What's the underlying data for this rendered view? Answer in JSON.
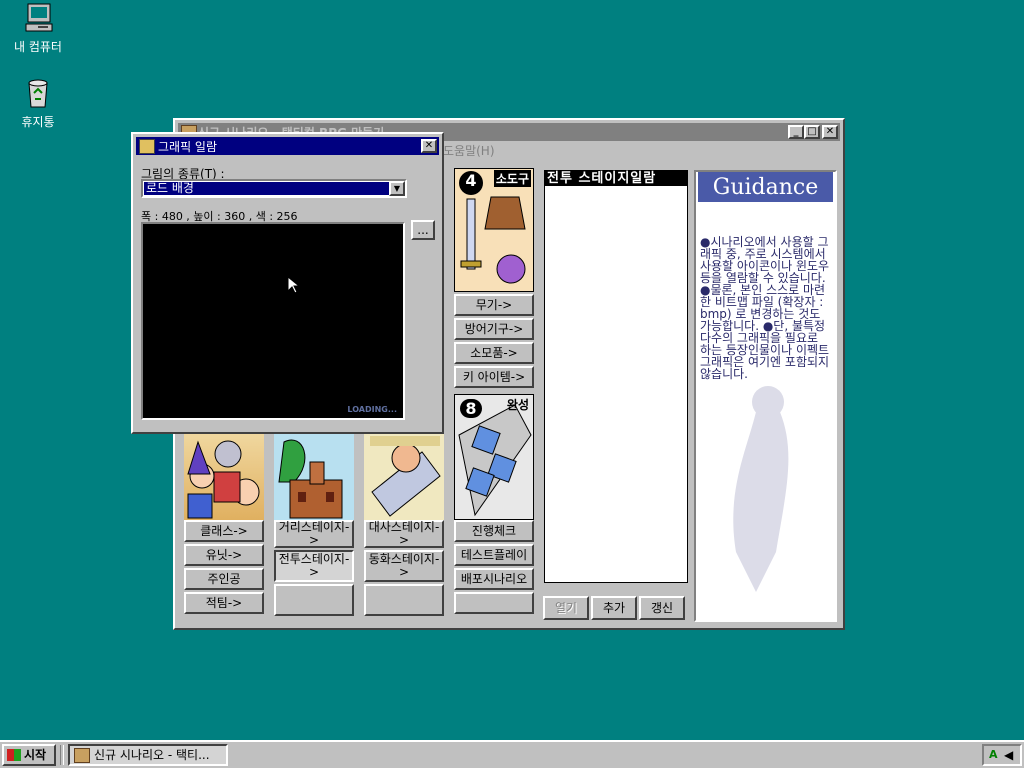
{
  "desktop": {
    "icons": [
      {
        "label": "내 컴퓨터",
        "icon": "my-computer-icon"
      },
      {
        "label": "휴지통",
        "icon": "recycle-bin-icon"
      }
    ]
  },
  "main_window": {
    "title": "신규 시나리오 - 택티컬 RPG 만들기",
    "menu_help": "도움말(H)",
    "columns": [
      {
        "buttons": [
          "클래스->",
          "유닛->",
          "주인공",
          "적팀->"
        ]
      },
      {
        "buttons": [
          "거리스테이지->",
          "전투스테이지->",
          ""
        ]
      },
      {
        "buttons": [
          "대사스테이지->",
          "동화스테이지->",
          ""
        ]
      }
    ],
    "item_panel": {
      "number": "4",
      "label": "소도구",
      "buttons": [
        "무기->",
        "방어기구->",
        "소모품->",
        "키 아이템->"
      ]
    },
    "complete_panel": {
      "number": "8",
      "label": "완성",
      "buttons": [
        "진행체크",
        "테스트플레이",
        "배포시나리오"
      ]
    },
    "battle_list": {
      "header": "전투 스테이지일람",
      "buttons": [
        "열기",
        "추가",
        "갱신"
      ]
    },
    "guidance": {
      "header": "Guidance",
      "text": "●시나리오에서 사용할 그래픽 중, 주로 시스템에서 사용할 아이콘이나 윈도우등을 열람할 수 있습니다. ●물론, 본인 스스로 마련한 비트맵 파일 (확장자 : bmp) 로 변경하는 것도 가능합니다. ●단, 불특정다수의 그래픽을 필요로 하는 등장인물이나 이펙트 그래픽은 여기엔 포함되지 않습니다."
    }
  },
  "graphic_dialog": {
    "title": "그래픽 일람",
    "type_label": "그림의 종류(T) :",
    "type_value": "로드 배경",
    "info": "폭 : 480 , 높이 : 360 , 색 : 256",
    "browse_label": "...",
    "preview_text": "LOADING..."
  },
  "taskbar": {
    "start_label": "시작",
    "task_label": "신규 시나리오 - 택티..."
  },
  "colors": {
    "desktop": "#008080",
    "face": "#c0c0c0",
    "active_title": "#000080",
    "inactive_title": "#808080",
    "guidance_header": "#4a5aa8"
  }
}
